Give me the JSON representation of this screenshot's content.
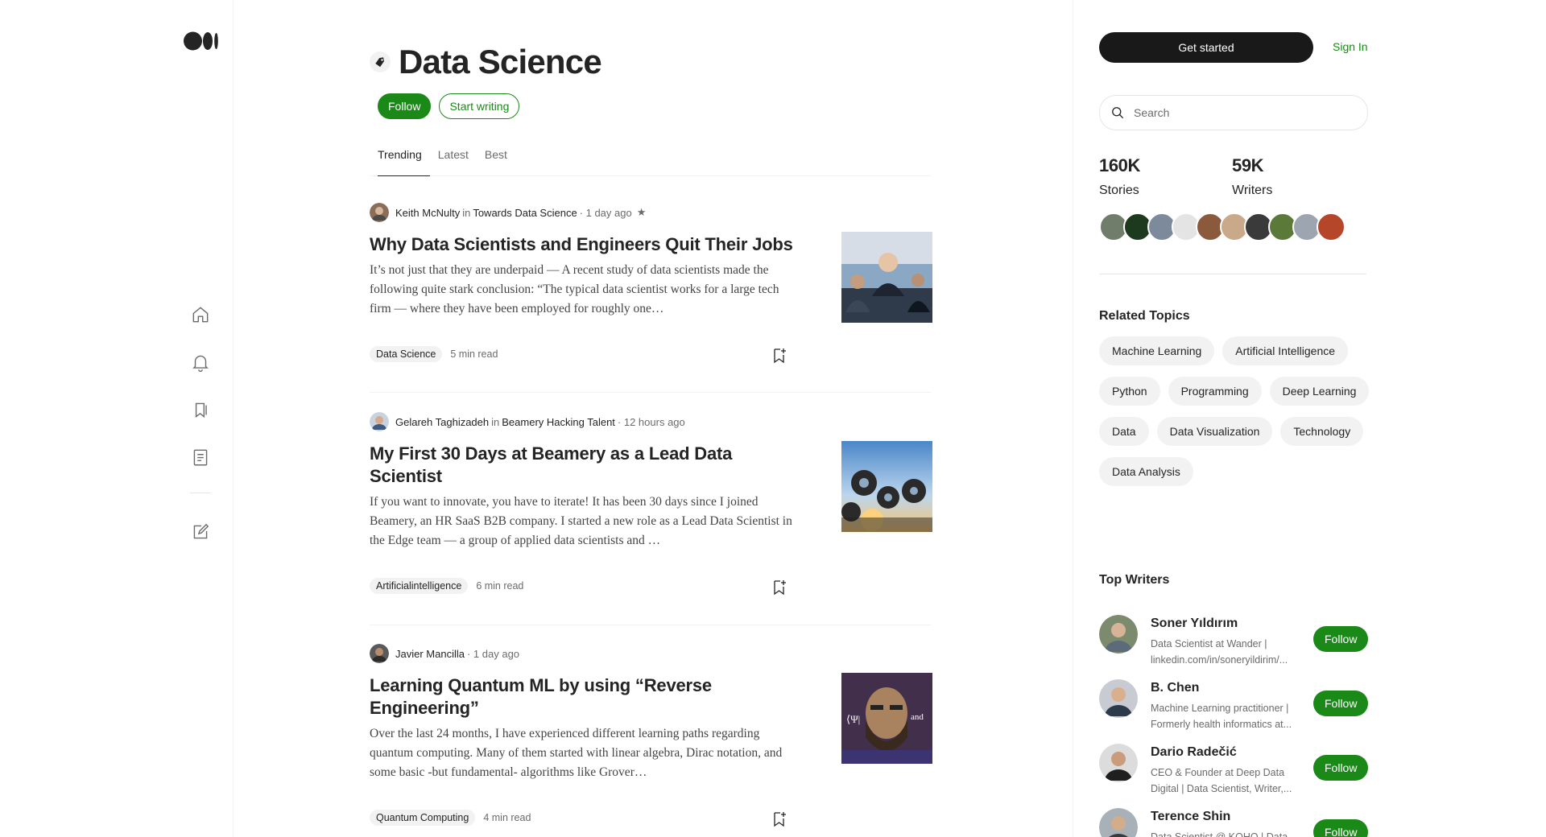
{
  "brand": {
    "logo": "medium-logo",
    "accent": "#1a8917"
  },
  "left_nav": {
    "icons": [
      "home-icon",
      "notifications-icon",
      "bookmarks-icon",
      "stories-icon",
      "write-icon"
    ]
  },
  "topic": {
    "title": "Data Science",
    "follow_label": "Follow",
    "start_writing_label": "Start writing"
  },
  "tabs": [
    {
      "label": "Trending",
      "active": true
    },
    {
      "label": "Latest",
      "active": false
    },
    {
      "label": "Best",
      "active": false
    }
  ],
  "articles": [
    {
      "author": "Keith McNulty",
      "in": "in",
      "publication": "Towards Data Science",
      "meta": "· 1 day ago",
      "star": "★",
      "title": "Why Data Scientists and Engineers Quit Their Jobs",
      "snippet": "It’s not just that they are underpaid — A recent study of data scientists made the following quite stark conclusion: “The typical data scientist works for a large tech firm — where they have been employed for roughly one…",
      "tag": "Data Science",
      "read_time": "5 min read"
    },
    {
      "author": "Gelareh Taghizadeh",
      "in": "in",
      "publication": "Beamery Hacking Talent",
      "meta": "· 12 hours ago",
      "title": "My First 30 Days at Beamery as a Lead Data Scientist",
      "snippet": "If you want to innovate, you have to iterate! It has been 30 days since I joined Beamery, an HR SaaS B2B company. I started a new role as a Lead Data Scientist in the Edge team — a group of applied data scientists and …",
      "tag": "Artificialintelligence",
      "read_time": "6 min read"
    },
    {
      "author": "Javier Mancilla",
      "meta": "· 1 day ago",
      "title": "Learning Quantum ML by using “Reverse Engineering”",
      "snippet": "Over the last 24 months, I have experienced different learning paths regarding quantum computing. Many of them started with linear algebra, Dirac notation, and some basic -but fundamental- algorithms like Grover…",
      "tag": "Quantum Computing",
      "read_time": "4 min read",
      "thumb_text": "and"
    }
  ],
  "sidebar": {
    "get_started_label": "Get started",
    "sign_in_label": "Sign In",
    "search_placeholder": "Search",
    "stats": {
      "stories_count": "160K",
      "stories_label": "Stories",
      "writers_count": "59K",
      "writers_label": "Writers"
    },
    "related_heading": "Related Topics",
    "related_topics": [
      "Machine Learning",
      "Artificial Intelligence",
      "Python",
      "Programming",
      "Deep Learning",
      "Data",
      "Data Visualization",
      "Technology",
      "Data Analysis"
    ],
    "top_writers_heading": "Top Writers",
    "top_writers": [
      {
        "name": "Soner Yıldırım",
        "bio": "Data Scientist at Wander | linkedin.com/in/soneryildirim/...",
        "follow": "Follow"
      },
      {
        "name": "B. Chen",
        "bio": "Machine Learning practitioner | Formerly health informatics at...",
        "follow": "Follow"
      },
      {
        "name": "Dario Radečić",
        "bio": "CEO & Founder at Deep Data Digital | Data Scientist, Writer,...",
        "follow": "Follow"
      },
      {
        "name": "Terence Shin",
        "bio": "Data Scientist @ KOHO | Data",
        "follow": "Follow"
      }
    ]
  }
}
